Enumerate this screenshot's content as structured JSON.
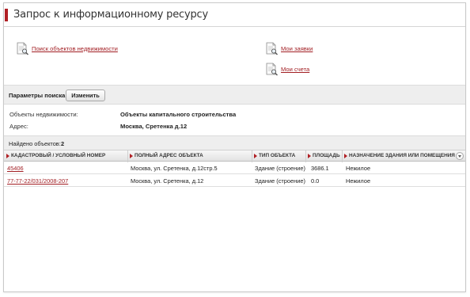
{
  "header": {
    "title": "Запрос к информационному ресурсу"
  },
  "links": {
    "search": {
      "label": "Поиск объектов недвижимости",
      "icon": "document-search-icon"
    },
    "my_requests": {
      "label": "Мои заявки",
      "icon": "document-search-icon"
    },
    "my_invoices": {
      "label": "Мои счета",
      "icon": "document-search-icon"
    }
  },
  "params": {
    "label": "Параметры поиска",
    "change_button": "Изменить"
  },
  "info": [
    {
      "label": "Объекты недвижимости:",
      "value": "Объекты капитального строительства"
    },
    {
      "label": "Адрес:",
      "value": "Москва, Сретенка д.12"
    }
  ],
  "found": {
    "label": "Найдено объектов:",
    "count": "2"
  },
  "table": {
    "columns": [
      "КАДАСТРОВЫЙ / УСЛОВНЫЙ НОМЕР",
      "ПОЛНЫЙ АДРЕС ОБЪЕКТА",
      "ТИП ОБЪЕКТА",
      "ПЛОЩАДЬ",
      "НАЗНАЧЕНИЕ ЗДАНИЯ ИЛИ ПОМЕЩЕНИЯ"
    ],
    "rows": [
      {
        "number": "45406",
        "address": "Москва, ул. Сретенка, д.12стр.5",
        "type": "Здание (строение)",
        "area": "3686.1",
        "purpose": "Нежилое"
      },
      {
        "number": "77-77-22/031/2008-207",
        "address": "Москва, ул. Сретенка, д.12",
        "type": "Здание (строение)",
        "area": "0.0",
        "purpose": "Нежилое"
      }
    ]
  },
  "colors": {
    "accent": "#b01f24",
    "link": "#a21f24",
    "bar_bg": "#eeeeee"
  }
}
